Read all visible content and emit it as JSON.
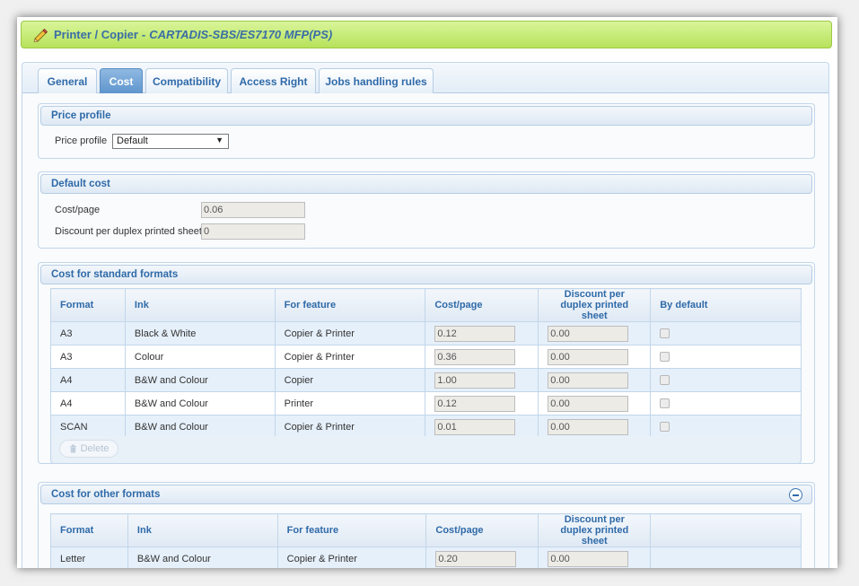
{
  "title": {
    "entity": "Printer / Copier",
    "separator": "-",
    "model": "CARTADIS-SBS/ES7170 MFP(PS)"
  },
  "tabs": [
    {
      "label": "General",
      "active": false
    },
    {
      "label": "Cost",
      "active": true
    },
    {
      "label": "Compatibility",
      "active": false
    },
    {
      "label": "Access Right",
      "active": false
    },
    {
      "label": "Jobs handling rules",
      "active": false
    }
  ],
  "price_profile": {
    "header": "Price profile",
    "label": "Price profile",
    "selected": "Default"
  },
  "default_cost": {
    "header": "Default cost",
    "cost_label": "Cost/page",
    "cost_value": "0.06",
    "discount_label": "Discount per duplex printed sheet",
    "discount_value": "0"
  },
  "standard_formats": {
    "header": "Cost for standard formats",
    "columns": [
      "Format",
      "Ink",
      "For feature",
      "Cost/page",
      "Discount per duplex printed sheet",
      "By default"
    ],
    "rows": [
      {
        "format": "A3",
        "ink": "Black & White",
        "feature": "Copier & Printer",
        "cost": "0.12",
        "discount": "0.00"
      },
      {
        "format": "A3",
        "ink": "Colour",
        "feature": "Copier & Printer",
        "cost": "0.36",
        "discount": "0.00"
      },
      {
        "format": "A4",
        "ink": "B&W and Colour",
        "feature": "Copier",
        "cost": "1.00",
        "discount": "0.00"
      },
      {
        "format": "A4",
        "ink": "B&W and Colour",
        "feature": "Printer",
        "cost": "0.12",
        "discount": "0.00"
      },
      {
        "format": "SCAN",
        "ink": "B&W and Colour",
        "feature": "Copier & Printer",
        "cost": "0.01",
        "discount": "0.00"
      }
    ],
    "delete_label": "Delete"
  },
  "other_formats": {
    "header": "Cost for other formats",
    "columns": [
      "Format",
      "Ink",
      "For feature",
      "Cost/page",
      "Discount per duplex printed sheet"
    ],
    "rows": [
      {
        "format": "Letter",
        "ink": "B&W and Colour",
        "feature": "Copier & Printer",
        "cost": "0.20",
        "discount": "0.00"
      }
    ]
  },
  "colors": {
    "title_green": "#b7e25b",
    "accent_blue": "#2f6aa8",
    "active_tab": "#5f95cd",
    "row_alt": "#e6f0fa"
  },
  "icons": {
    "title": "pencil-icon",
    "delete": "trash-icon",
    "collapse": "minus-circle-icon",
    "dropdown": "caret-down-icon"
  }
}
